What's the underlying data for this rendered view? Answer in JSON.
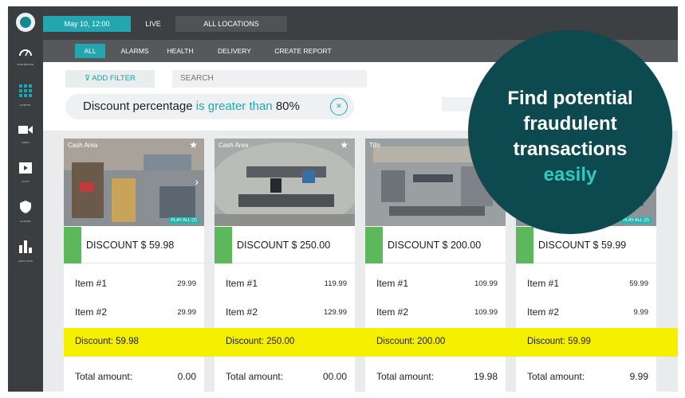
{
  "topbar": {
    "date": "May 10, 12:00",
    "live": "LIVE",
    "locations": "ALL LOCATIONS"
  },
  "sidebar": {
    "items": [
      {
        "icon": "dashboard-icon",
        "label": "DASHBOARD"
      },
      {
        "icon": "grid-icon",
        "label": "EVENTS"
      },
      {
        "icon": "video-camera-icon",
        "label": "VIDEO"
      },
      {
        "icon": "clips-icon",
        "label": "CLIPS"
      },
      {
        "icon": "shield-icon",
        "label": "ALARMS"
      },
      {
        "icon": "bar-chart-icon",
        "label": "ANALYTICS"
      }
    ]
  },
  "tabs": [
    "ALL",
    "ALARMS",
    "HEALTH",
    "DELIVERY",
    "CREATE REPORT"
  ],
  "filter": {
    "add_filter": "ADD FILTER",
    "search_placeholder": "SEARCH",
    "chip": {
      "field": "Discount percentage",
      "operator": "is greater than",
      "value": "80%",
      "close": "×"
    }
  },
  "cards": [
    {
      "camera": "Cash Area",
      "play_all": "PLAY ALL (2)",
      "discount_header": "DISCOUNT $ 59.98",
      "items": [
        {
          "name": "Item #1",
          "price": "29.99"
        },
        {
          "name": "Item #2",
          "price": "29.99"
        }
      ],
      "discount_line": "Discount: 59.98",
      "total_label": "Total amount:",
      "total": "0.00"
    },
    {
      "camera": "Cash Area",
      "play_all": "",
      "discount_header": "DISCOUNT $ 250.00",
      "items": [
        {
          "name": "Item #1",
          "price": "119.99"
        },
        {
          "name": "Item #2",
          "price": "129.99"
        }
      ],
      "discount_line": "Discount: 250.00",
      "total_label": "Total amount:",
      "total": "00.00"
    },
    {
      "camera": "Tills",
      "play_all": "",
      "discount_header": "DISCOUNT $ 200.00",
      "items": [
        {
          "name": "Item #1",
          "price": "109.99"
        },
        {
          "name": "Item #2",
          "price": "109.99"
        }
      ],
      "discount_line": "Discount: 200.00",
      "total_label": "Total amount:",
      "total": "19.98"
    },
    {
      "camera": "",
      "play_all": "PLAY ALL (2)",
      "discount_header": "DISCOUNT $ 59.99",
      "items": [
        {
          "name": "Item #1",
          "price": "59.99"
        },
        {
          "name": "Item #2",
          "price": "9.99"
        }
      ],
      "discount_line": "Discount: 59.99",
      "total_label": "Total amount:",
      "total": "9.99"
    }
  ],
  "promo": {
    "line1": "Find potential",
    "line2": "fraudulent",
    "line3": "transactions",
    "accent": "easily"
  },
  "colors": {
    "teal": "#22a7b0",
    "green_bar": "#5cb85a",
    "highlight": "#f5ef00",
    "promo_bg": "#0d4a50"
  }
}
